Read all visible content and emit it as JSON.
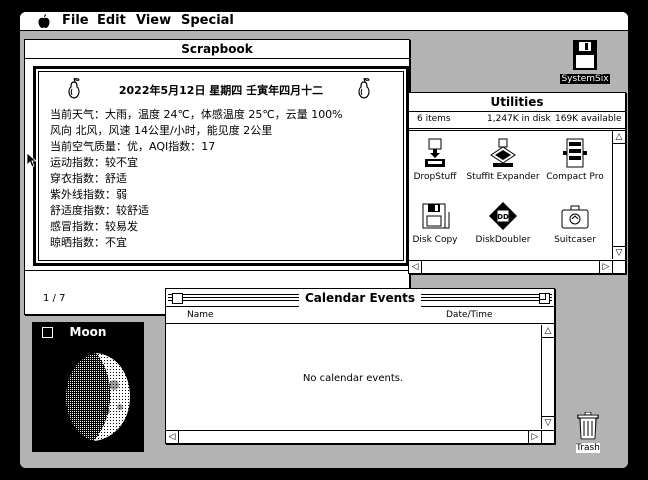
{
  "menubar": {
    "apple": "",
    "items": [
      "File",
      "Edit",
      "View",
      "Special"
    ]
  },
  "scrapbook": {
    "title": "Scrapbook",
    "header": "2022年5月12日  星期四  壬寅年四月十二",
    "lines": [
      "当前天气：大雨，温度 24℃，体感温度 25℃，云量 100%",
      "风向 北风，风速 14公里/小时，能见度 2公里",
      "当前空气质量：优，AQI指数：17",
      "运动指数：较不宜",
      "穿衣指数：舒适",
      "紫外线指数：弱",
      "舒适度指数：较舒适",
      "感冒指数：较易发",
      "晾晒指数：不宜"
    ],
    "page": "1 / 7"
  },
  "utilities": {
    "title": "Utilities",
    "items_count": "6 items",
    "in_disk": "1,247K in disk",
    "available": "169K available",
    "icons": [
      {
        "name": "DropStuff"
      },
      {
        "name": "StuffIt Expander"
      },
      {
        "name": "Compact Pro"
      },
      {
        "name": "Disk Copy"
      },
      {
        "name": "DiskDoubler"
      },
      {
        "name": "Suitcaser"
      }
    ]
  },
  "moon": {
    "title": "Moon"
  },
  "calendar": {
    "title": "Calendar Events",
    "col_name": "Name",
    "col_date": "Date/Time",
    "empty": "No calendar events."
  },
  "desktop": {
    "disk_label": "SystemSix",
    "trash_label": "Trash"
  }
}
